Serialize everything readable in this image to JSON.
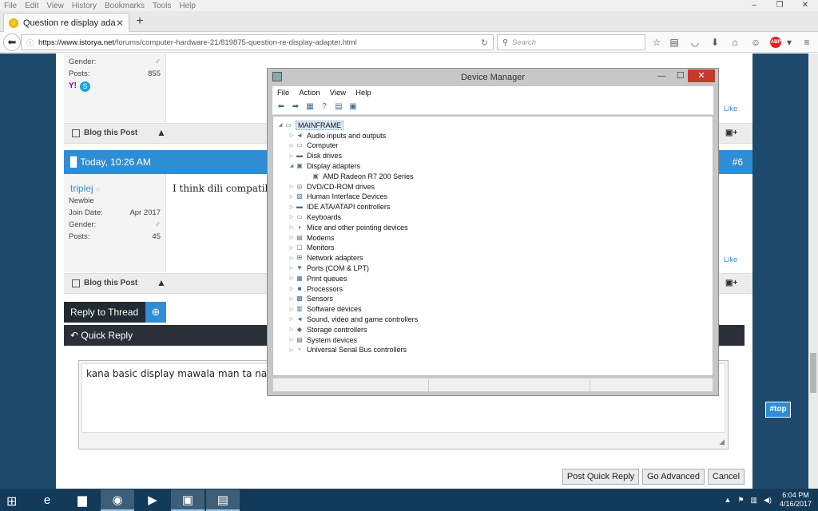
{
  "browser": {
    "menu": [
      "File",
      "Edit",
      "View",
      "History",
      "Bookmarks",
      "Tools",
      "Help"
    ],
    "window_controls": [
      "–",
      "❐",
      "✕"
    ],
    "tab_title": "Question re display adapter",
    "new_tab": "+",
    "url_domain": "https://www.istorya.net",
    "url_path": "/forums/computer-hardware-21/819875-question-re-display-adapter.html",
    "search_placeholder": "Search"
  },
  "post1": {
    "gender_label": "Gender:",
    "posts_label": "Posts:",
    "posts_value": "855",
    "blog_label": "Blog this Post",
    "like_label": "Like"
  },
  "post2": {
    "date": "Today, 10:26 AM",
    "number": "#6",
    "username": "triplej",
    "rank": "Newbie",
    "join_label": "Join Date:",
    "join_value": "Apr 2017",
    "gender_label": "Gender:",
    "posts_label": "Posts:",
    "posts_value": "45",
    "text": "I think dili compatibl",
    "blog_label": "Blog this Post",
    "like_label": "Like"
  },
  "reply": {
    "reply_to_thread": "Reply to Thread",
    "quick_reply": "Quick Reply",
    "editor_text": "kana basic display mawala man ta na ba",
    "post_quick_reply": "Post Quick Reply",
    "go_advanced": "Go Advanced",
    "cancel": "Cancel",
    "top": "#top"
  },
  "device_manager": {
    "title": "Device Manager",
    "menu": [
      "File",
      "Action",
      "View",
      "Help"
    ],
    "root": "MAINFRAME",
    "nodes": [
      {
        "label": "Audio inputs and outputs",
        "icon": "speaker-icon"
      },
      {
        "label": "Computer",
        "icon": "computer-icon"
      },
      {
        "label": "Disk drives",
        "icon": "disk-icon"
      },
      {
        "label": "Display adapters",
        "icon": "display-icon",
        "expanded": true
      },
      {
        "label": "AMD Radeon R7 200 Series",
        "icon": "display-icon",
        "child": true
      },
      {
        "label": "DVD/CD-ROM drives",
        "icon": "dvd-icon"
      },
      {
        "label": "Human Interface Devices",
        "icon": "hid-icon"
      },
      {
        "label": "IDE ATA/ATAPI controllers",
        "icon": "ide-icon"
      },
      {
        "label": "Keyboards",
        "icon": "keyboard-icon"
      },
      {
        "label": "Mice and other pointing devices",
        "icon": "mouse-icon"
      },
      {
        "label": "Modems",
        "icon": "modem-icon"
      },
      {
        "label": "Monitors",
        "icon": "monitor-icon"
      },
      {
        "label": "Network adapters",
        "icon": "network-icon"
      },
      {
        "label": "Ports (COM & LPT)",
        "icon": "port-icon"
      },
      {
        "label": "Print queues",
        "icon": "printer-icon"
      },
      {
        "label": "Processors",
        "icon": "cpu-icon"
      },
      {
        "label": "Sensors",
        "icon": "sensor-icon"
      },
      {
        "label": "Software devices",
        "icon": "software-icon"
      },
      {
        "label": "Sound, video and game controllers",
        "icon": "sound-icon"
      },
      {
        "label": "Storage controllers",
        "icon": "storage-icon"
      },
      {
        "label": "System devices",
        "icon": "system-icon"
      },
      {
        "label": "Universal Serial Bus controllers",
        "icon": "usb-icon"
      }
    ]
  },
  "taskbar": {
    "time": "6:04 PM",
    "date": "4/16/2017"
  }
}
